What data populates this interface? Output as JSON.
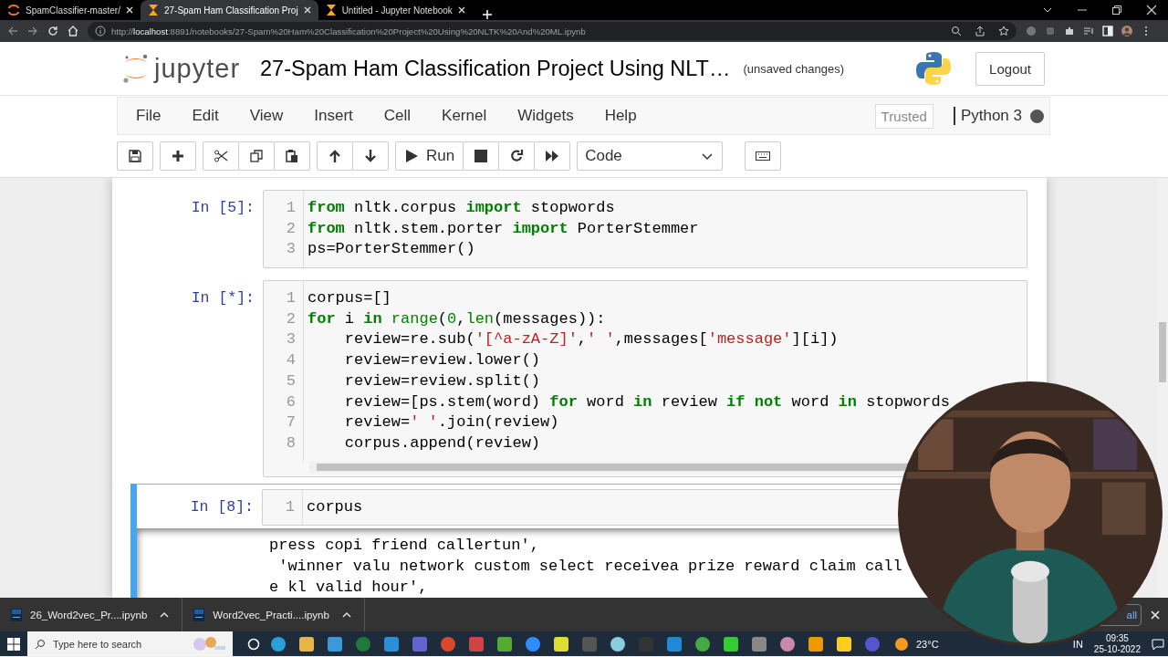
{
  "browser": {
    "tabs": [
      {
        "title": "SpamClassifier-master/",
        "selected": false
      },
      {
        "title": "27-Spam Ham Classification Proj",
        "selected": true
      },
      {
        "title": "Untitled - Jupyter Notebook",
        "selected": false
      }
    ],
    "url": "http://**localhost**:8891/notebooks/27-Spam%20Ham%20Classification%20Project%20Using%20NLTK%20And%20ML.ipynb"
  },
  "header": {
    "logo_text": "jupyter",
    "title": "27-Spam Ham Classification Project Using NLT…",
    "status": "(unsaved changes)",
    "logout": "Logout"
  },
  "menubar": {
    "menus": [
      "File",
      "Edit",
      "View",
      "Insert",
      "Cell",
      "Kernel",
      "Widgets",
      "Help"
    ],
    "trusted": "Trusted",
    "kernel": "Python 3",
    "kernel_busy": true
  },
  "toolbar": {
    "run": "Run",
    "cell_type": "Code"
  },
  "cells": [
    {
      "prompt": "In [5]:",
      "selected": false,
      "lines": [
        {
          "number": "1",
          "code": [
            {
              "kind": "kw",
              "text": "from"
            },
            {
              "kind": "plain",
              "text": " nltk.corpus "
            },
            {
              "kind": "kw",
              "text": "import"
            },
            {
              "kind": "plain",
              "text": " stopwords"
            }
          ]
        },
        {
          "number": "2",
          "code": [
            {
              "kind": "kw",
              "text": "from"
            },
            {
              "kind": "plain",
              "text": " nltk.stem.porter "
            },
            {
              "kind": "kw",
              "text": "import"
            },
            {
              "kind": "plain",
              "text": " PorterStemmer"
            }
          ]
        },
        {
          "number": "3",
          "code": [
            {
              "kind": "plain",
              "text": "ps=PorterStemmer()"
            }
          ]
        }
      ]
    },
    {
      "prompt": "In [*]:",
      "selected": false,
      "lines": [
        {
          "number": "1",
          "code": [
            {
              "kind": "plain",
              "text": "corpus=[]"
            }
          ]
        },
        {
          "number": "2",
          "code": [
            {
              "kind": "kw",
              "text": "for"
            },
            {
              "kind": "plain",
              "text": " i "
            },
            {
              "kind": "kw",
              "text": "in"
            },
            {
              "kind": "bi",
              "text": " range"
            },
            {
              "kind": "plain",
              "text": "("
            },
            {
              "kind": "num",
              "text": "0"
            },
            {
              "kind": "plain",
              "text": ","
            },
            {
              "kind": "bi",
              "text": "len"
            },
            {
              "kind": "plain",
              "text": "(messages)):"
            }
          ]
        },
        {
          "number": "3",
          "code": [
            {
              "kind": "plain",
              "text": "    review=re.sub("
            },
            {
              "kind": "str",
              "text": "'[^a-zA-Z]'"
            },
            {
              "kind": "plain",
              "text": ","
            },
            {
              "kind": "str",
              "text": "' '"
            },
            {
              "kind": "plain",
              "text": ",messages["
            },
            {
              "kind": "str",
              "text": "'message'"
            },
            {
              "kind": "plain",
              "text": "][i])"
            }
          ]
        },
        {
          "number": "4",
          "code": [
            {
              "kind": "plain",
              "text": "    review=review.lower()"
            }
          ]
        },
        {
          "number": "5",
          "code": [
            {
              "kind": "plain",
              "text": "    review=review.split()"
            }
          ]
        },
        {
          "number": "6",
          "code": [
            {
              "kind": "plain",
              "text": "    review=[ps.stem(word) "
            },
            {
              "kind": "kw",
              "text": "for"
            },
            {
              "kind": "plain",
              "text": " word "
            },
            {
              "kind": "kw",
              "text": "in"
            },
            {
              "kind": "plain",
              "text": " review "
            },
            {
              "kind": "kw",
              "text": "if not"
            },
            {
              "kind": "plain",
              "text": " word "
            },
            {
              "kind": "kw",
              "text": "in"
            },
            {
              "kind": "plain",
              "text": " stopwords"
            }
          ]
        },
        {
          "number": "7",
          "code": [
            {
              "kind": "plain",
              "text": "    review="
            },
            {
              "kind": "str",
              "text": "' '"
            },
            {
              "kind": "plain",
              "text": ".join(review)"
            }
          ]
        },
        {
          "number": "8",
          "code": [
            {
              "kind": "plain",
              "text": "    corpus.append(review)"
            }
          ]
        }
      ]
    },
    {
      "prompt": "In [8]:",
      "selected": true,
      "lines": [
        {
          "number": "1",
          "code": [
            {
              "kind": "plain",
              "text": "corpus"
            }
          ]
        }
      ],
      "output": [
        "press copi friend callertun',",
        " 'winner valu network custom select receivea prize reward claim call",
        "e kl valid hour',"
      ]
    }
  ],
  "downloads": {
    "items": [
      "26_Word2vec_Pr....ipynb",
      "Word2vec_Practi....ipynb"
    ],
    "show_all": "all"
  },
  "taskbar": {
    "search_placeholder": "Type here to search",
    "weather": "23°C",
    "language": "IN",
    "time": "09:35",
    "date": "25-10-2022"
  }
}
